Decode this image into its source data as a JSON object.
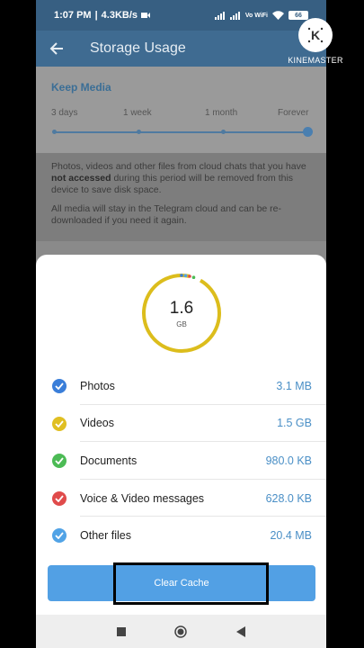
{
  "status_bar": {
    "time": "1:07 PM",
    "speed": "4.3KB/s",
    "network": "Vo WiFi",
    "battery": "66"
  },
  "app_bar": {
    "title": "Storage Usage"
  },
  "keep_media": {
    "title": "Keep Media",
    "options": [
      "3 days",
      "1 week",
      "1 month",
      "Forever"
    ],
    "selected": "Forever"
  },
  "info": {
    "para1_start": "Photos, videos and other files from cloud chats that you have ",
    "para1_bold": "not accessed",
    "para1_end": " during this period will be removed from this device to save disk space.",
    "para2": "All media will stay in the Telegram cloud and can be re-downloaded if you need it again."
  },
  "storage": {
    "total_value": "1.6",
    "total_unit": "GB",
    "items": [
      {
        "label": "Photos",
        "value": "3.1 MB",
        "color": "#3a7ed9"
      },
      {
        "label": "Videos",
        "value": "1.5 GB",
        "color": "#e0bf22"
      },
      {
        "label": "Documents",
        "value": "980.0 KB",
        "color": "#4cbb55"
      },
      {
        "label": "Voice & Video messages",
        "value": "628.0 KB",
        "color": "#e04b4b"
      },
      {
        "label": "Other files",
        "value": "20.4 MB",
        "color": "#51a3e6"
      }
    ]
  },
  "actions": {
    "clear_cache": "Clear Cache"
  },
  "watermark": {
    "text": "KINEMASTER"
  }
}
